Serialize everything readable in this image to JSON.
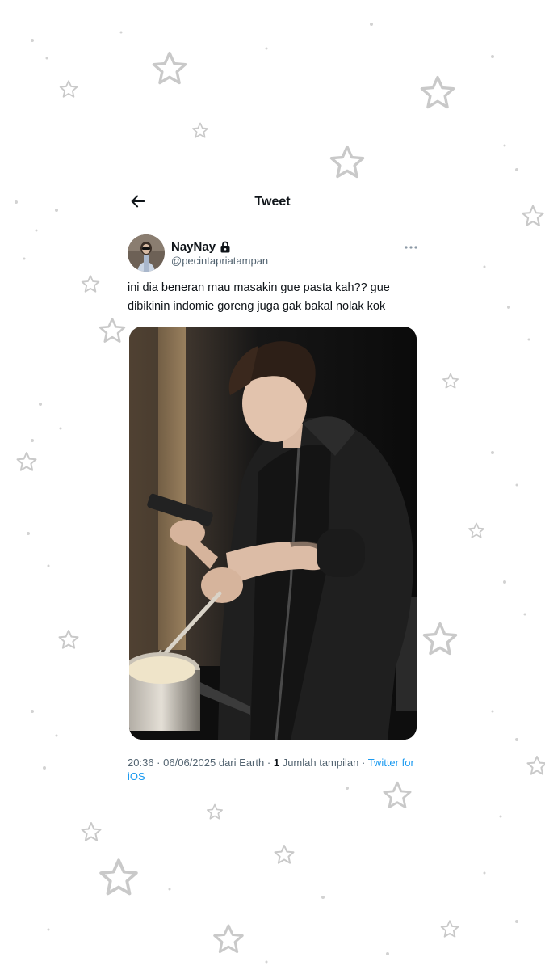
{
  "header": {
    "title": "Tweet",
    "back_icon": "arrow-left-icon"
  },
  "tweet": {
    "author_name": "NayNay",
    "handle": "@pecintapriatampan",
    "text": "ini dia beneran mau masakin gue pasta kah?? gue dibikinin indomie goreng juga gak bakal nolak kok",
    "meta": {
      "time": "20:36",
      "date": "06/06/2025",
      "location_prefix": "dari",
      "location": "Earth",
      "views_count": "1",
      "views_label": "Jumlah tampilan",
      "client": "Twitter for iOS",
      "separator": "·"
    }
  },
  "icons": {
    "protected": "lock-icon",
    "more": "more-horizontal-icon"
  },
  "colors": {
    "link": "#1d9bf0",
    "secondary_text": "#536471",
    "primary_text": "#0f1419"
  }
}
